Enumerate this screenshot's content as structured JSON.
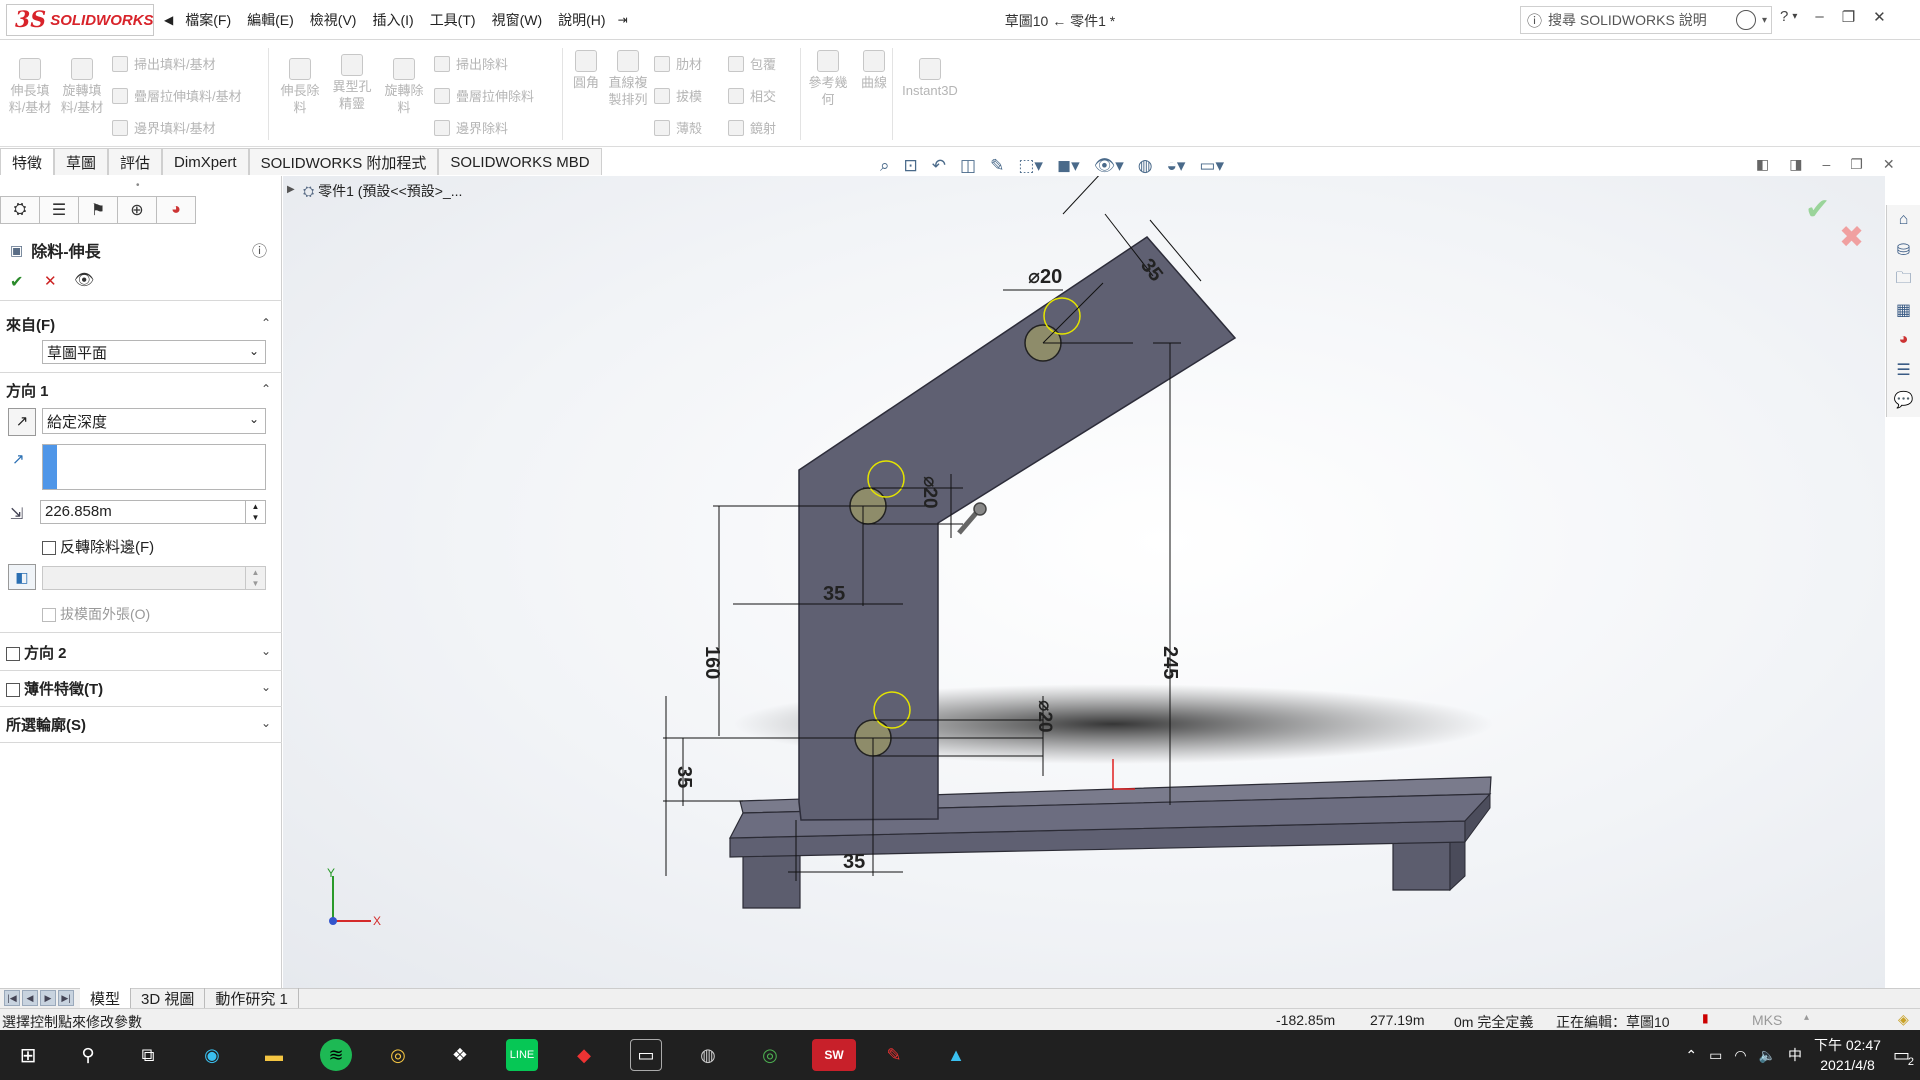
{
  "app": {
    "brand_ds": "3S",
    "brand": "SOLIDWORKS",
    "doc_title": "草圖10 ← 零件1 *"
  },
  "menu": [
    "檔案(F)",
    "編輯(E)",
    "檢視(V)",
    "插入(I)",
    "工具(T)",
    "視窗(W)",
    "說明(H)"
  ],
  "search": {
    "placeholder": "搜尋 SOLIDWORKS 說明"
  },
  "ribbon": {
    "big": [
      "伸長填料/基材",
      "旋轉填料/基材",
      "伸長除料",
      "異型孔精靈",
      "旋轉除料",
      "圓角",
      "直線複製排列",
      "參考幾何",
      "曲線",
      "Instant3D"
    ],
    "small": [
      "掃出填料/基材",
      "疊層拉伸填料/基材",
      "邊界填料/基材",
      "掃出除料",
      "疊層拉伸除料",
      "邊界除料",
      "肋材",
      "包覆",
      "拔模",
      "相交",
      "薄殼",
      "鏡射"
    ]
  },
  "tabs": [
    "特徵",
    "草圖",
    "評估",
    "DimXpert",
    "SOLIDWORKS 附加程式",
    "SOLIDWORKS MBD"
  ],
  "panel": {
    "title": "除料-伸長",
    "from_label": "來自(F)",
    "from_value": "草圖平面",
    "dir1_label": "方向 1",
    "dir1_value": "給定深度",
    "depth": "226.858m",
    "reverse_label": "反轉除料邊(F)",
    "draft_label": "拔模面外張(O)",
    "dir2_label": "方向 2",
    "thin_label": "薄件特徵(T)",
    "contours_label": "所選輪廓(S)"
  },
  "tree": {
    "root": "零件1 (預設<<預設>_..."
  },
  "dims": {
    "d1": "⌀20",
    "d2": "35",
    "d3": "⌀20",
    "d4": "35",
    "d5": "160",
    "d6": "245",
    "d7": "⌀20",
    "d8": "35",
    "d9": "35"
  },
  "axis": {
    "y": "Y",
    "x": "X"
  },
  "bottom_tabs": [
    "模型",
    "3D 視圖",
    "動作研究 1"
  ],
  "status": {
    "hint": "選擇控制點來修改參數",
    "x": "-182.85m",
    "y": "277.19m",
    "z": "0m 完全定義",
    "editing": "正在編輯：草圖10",
    "units": "MKS"
  },
  "clock": {
    "time": "下午 02:47",
    "date": "2021/4/8"
  },
  "tray": {
    "ime": "中",
    "notif": "2"
  }
}
